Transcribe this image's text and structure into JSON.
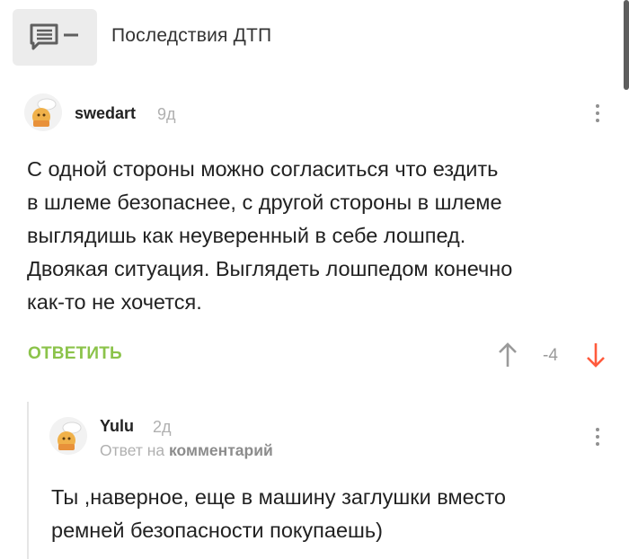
{
  "post": {
    "title": "Последствия ДТП",
    "icon": "comment-list-icon"
  },
  "comments": [
    {
      "username": "swedart",
      "time": "9д",
      "text": "С одной стороны можно согласиться что ездить в шлеме безопаснее, с другой стороны в шлеме выглядишь как неуверенный в себе лошпед. Двоякая ситуация. Выглядеть лошпедом конечно как-то не хочется.",
      "lines": [
        "С одной стороны можно согласиться что ездить",
        "в шлеме безопаснее, с другой стороны в шлеме",
        "выглядишь как неуверенный в себе лошпед.",
        "Двоякая ситуация. Выглядеть лошпедом конечно",
        "как-то не хочется."
      ],
      "reply_label": "ОТВЕТИТЬ",
      "score": "-4",
      "icons": {
        "avatar": "baker-avatar-icon",
        "more": "more-vertical-icon",
        "up": "arrow-up-icon",
        "down": "arrow-down-icon"
      },
      "colors": {
        "reply": "#8bc34a",
        "downvote": "#ff5a3c"
      }
    },
    {
      "username": "Yulu",
      "time": "2д",
      "reply_prefix": "Ответ на",
      "reply_target": "комментарий",
      "lines": [
        "Ты ,наверное, еще в машину заглушки вместо",
        "ремней безопасности покупаешь)"
      ]
    }
  ]
}
